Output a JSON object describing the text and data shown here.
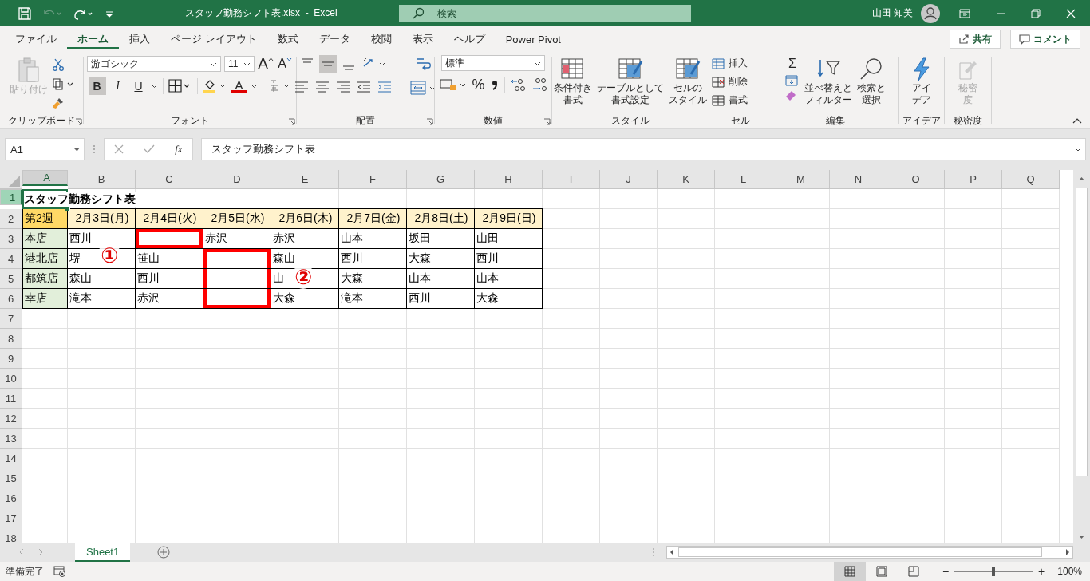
{
  "title_bar": {
    "undo_disabled": true,
    "title": "スタッフ勤務シフト表.xlsx  -  Excel",
    "search": {
      "placeholder": "検索"
    },
    "user": "山田 知美"
  },
  "menu_tabs": [
    {
      "label": "ファイル",
      "selected": false
    },
    {
      "label": "ホーム",
      "selected": true
    },
    {
      "label": "挿入",
      "selected": false
    },
    {
      "label": "ページ レイアウト",
      "selected": false
    },
    {
      "label": "数式",
      "selected": false
    },
    {
      "label": "データ",
      "selected": false
    },
    {
      "label": "校閲",
      "selected": false
    },
    {
      "label": "表示",
      "selected": false
    },
    {
      "label": "ヘルプ",
      "selected": false
    },
    {
      "label": "Power Pivot",
      "selected": false
    }
  ],
  "share_button": "共有",
  "comment_button": "コメント",
  "ribbon": {
    "clipboard": {
      "paste": "貼り付け",
      "paste_disabled": true,
      "label": "クリップボード"
    },
    "font": {
      "font_name": "游ゴシック",
      "font_size": "11",
      "grow": "A",
      "shrink": "A",
      "style_buttons": [
        {
          "label": "B",
          "active": true
        },
        {
          "label": "I",
          "active": false
        },
        {
          "label": "U",
          "active": false
        }
      ],
      "color_letter": "A",
      "label": "フォント"
    },
    "alignment": {
      "middle_active": true,
      "label": "配置"
    },
    "number": {
      "format": "標準",
      "percent": "%",
      "label": "数値"
    },
    "styles": {
      "buttons": [
        [
          "条件付き",
          "書式"
        ],
        [
          "テーブルとして",
          "書式設定"
        ],
        [
          "セルの",
          "スタイル"
        ]
      ],
      "label": "スタイル"
    },
    "cells": {
      "insert": "挿入",
      "delete": "削除",
      "format": "書式",
      "label": "セル"
    },
    "editing": {
      "autosum": "Σ",
      "sort": [
        "並べ替えと",
        "フィルター"
      ],
      "find": [
        "検索と",
        "選択"
      ],
      "label": "編集"
    },
    "ideas": {
      "button": [
        "アイ",
        "デア"
      ],
      "label": "アイデア"
    },
    "sensitivity": {
      "button": [
        "秘密",
        "度"
      ],
      "disabled": true,
      "label": "秘密度"
    }
  },
  "formula_bar": {
    "name_box": "A1",
    "fx": "fx",
    "formula": "スタッフ勤務シフト表"
  },
  "sheet": {
    "columns": [
      {
        "label": "A",
        "selected": true
      },
      {
        "label": "B",
        "selected": false
      },
      {
        "label": "C",
        "selected": false
      },
      {
        "label": "D",
        "selected": false
      },
      {
        "label": "E",
        "selected": false
      },
      {
        "label": "F",
        "selected": false
      },
      {
        "label": "G",
        "selected": false
      },
      {
        "label": "H",
        "selected": false
      },
      {
        "label": "I",
        "selected": false
      },
      {
        "label": "J",
        "selected": false
      },
      {
        "label": "K",
        "selected": false
      },
      {
        "label": "L",
        "selected": false
      },
      {
        "label": "M",
        "selected": false
      },
      {
        "label": "N",
        "selected": false
      },
      {
        "label": "O",
        "selected": false
      },
      {
        "label": "P",
        "selected": false
      },
      {
        "label": "Q",
        "selected": false
      }
    ],
    "row_numbers": [
      {
        "label": "1",
        "selected": true
      },
      {
        "label": "2",
        "selected": false
      },
      {
        "label": "3",
        "selected": false
      },
      {
        "label": "4",
        "selected": false
      },
      {
        "label": "5",
        "selected": false
      },
      {
        "label": "6",
        "selected": false
      },
      {
        "label": "7",
        "selected": false
      },
      {
        "label": "8",
        "selected": false
      },
      {
        "label": "9",
        "selected": false
      },
      {
        "label": "10",
        "selected": false
      },
      {
        "label": "11",
        "selected": false
      },
      {
        "label": "12",
        "selected": false
      },
      {
        "label": "13",
        "selected": false
      },
      {
        "label": "14",
        "selected": false
      },
      {
        "label": "15",
        "selected": false
      },
      {
        "label": "16",
        "selected": false
      },
      {
        "label": "17",
        "selected": false
      },
      {
        "label": "18",
        "selected": false
      }
    ],
    "title": "スタッフ勤務シフト表",
    "header": [
      {
        "text": "第2週",
        "kind": "week"
      },
      {
        "text": "2月3日(月)",
        "kind": "date"
      },
      {
        "text": "2月4日(火)",
        "kind": "date"
      },
      {
        "text": "2月5日(水)",
        "kind": "date"
      },
      {
        "text": "2月6日(木)",
        "kind": "date"
      },
      {
        "text": "2月7日(金)",
        "kind": "date"
      },
      {
        "text": "2月8日(土)",
        "kind": "date"
      },
      {
        "text": "2月9日(日)",
        "kind": "date"
      }
    ],
    "rows": [
      {
        "store": "本店",
        "cells": [
          {
            "text": "西川"
          },
          {
            "highlighted": true
          },
          {
            "text": "赤沢"
          },
          {
            "text": "赤沢"
          },
          {
            "text": "山本"
          },
          {
            "text": "坂田"
          },
          {
            "text": "山田"
          }
        ]
      },
      {
        "store": "港北店",
        "cells": [
          {
            "text": "堺"
          },
          {
            "text": "笹山"
          },
          {
            "highlighted": true
          },
          {
            "text": "森山"
          },
          {
            "text": "西川"
          },
          {
            "text": "大森"
          },
          {
            "text": "西川"
          }
        ]
      },
      {
        "store": "都筑店",
        "cells": [
          {
            "text": "森山"
          },
          {
            "text": "西川"
          },
          {
            "highlighted": true
          },
          {
            "text": "山"
          },
          {
            "text": "大森"
          },
          {
            "text": "山本"
          },
          {
            "text": "山本"
          }
        ]
      },
      {
        "store": "幸店",
        "cells": [
          {
            "text": "滝本"
          },
          {
            "text": "赤沢"
          },
          {
            "highlighted": true
          },
          {
            "text": "大森"
          },
          {
            "text": "滝本"
          },
          {
            "text": "西川"
          },
          {
            "text": "大森"
          }
        ]
      }
    ],
    "annotations": [
      "①",
      "②"
    ]
  },
  "sheet_tabs": [
    {
      "label": "Sheet1",
      "selected": true
    }
  ],
  "status_bar": {
    "status": "準備完了",
    "views": [
      {
        "selected": true
      },
      {
        "selected": false
      },
      {
        "selected": false
      }
    ],
    "zoom_out": "−",
    "zoom_in": "+",
    "zoom": {
      "level": 0.5,
      "reading": "100%"
    }
  }
}
